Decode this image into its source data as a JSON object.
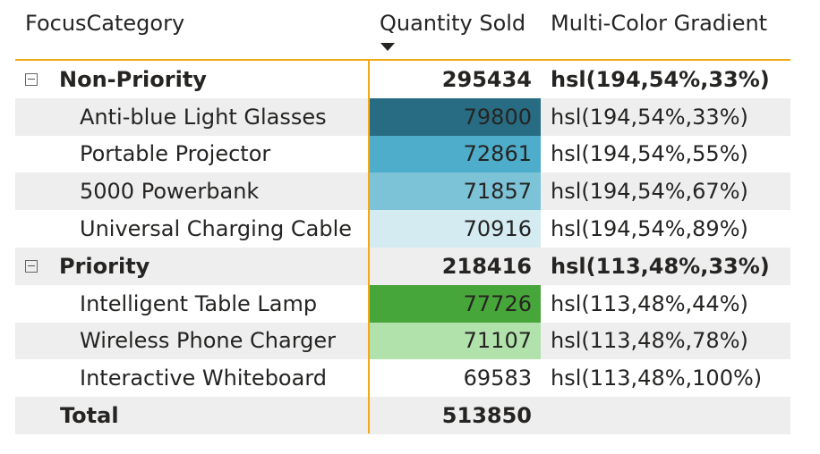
{
  "headers": {
    "category": "FocusCategory",
    "quantity": "Quantity Sold",
    "gradient": "Multi-Color Gradient"
  },
  "sort": {
    "column": "Quantity Sold",
    "direction": "descending"
  },
  "accent_color": "#f2a818",
  "rows": [
    {
      "type": "group",
      "label": "Non-Priority",
      "quantity": "295434",
      "gradient": "hsl(194,54%,33%)",
      "expanded": true
    },
    {
      "type": "item",
      "label": "Anti-blue Light Glasses",
      "quantity": "79800",
      "gradient": "hsl(194,54%,33%)",
      "cell_color": "hsl(194,54%,33%)"
    },
    {
      "type": "item",
      "label": "Portable Projector",
      "quantity": "72861",
      "gradient": "hsl(194,54%,55%)",
      "cell_color": "hsl(194,54%,55%)"
    },
    {
      "type": "item",
      "label": "5000 Powerbank",
      "quantity": "71857",
      "gradient": "hsl(194,54%,67%)",
      "cell_color": "hsl(194,54%,67%)"
    },
    {
      "type": "item",
      "label": "Universal Charging Cable",
      "quantity": "70916",
      "gradient": "hsl(194,54%,89%)",
      "cell_color": "hsl(194,54%,89%)"
    },
    {
      "type": "group",
      "label": "Priority",
      "quantity": "218416",
      "gradient": "hsl(113,48%,33%)",
      "expanded": true
    },
    {
      "type": "item",
      "label": "Intelligent Table Lamp",
      "quantity": "77726",
      "gradient": "hsl(113,48%,44%)",
      "cell_color": "hsl(113,48%,44%)"
    },
    {
      "type": "item",
      "label": "Wireless Phone Charger",
      "quantity": "71107",
      "gradient": "hsl(113,48%,78%)",
      "cell_color": "hsl(113,48%,78%)"
    },
    {
      "type": "item",
      "label": "Interactive Whiteboard",
      "quantity": "69583",
      "gradient": "hsl(113,48%,100%)",
      "cell_color": "hsl(113,48%,100%)"
    },
    {
      "type": "total",
      "label": "Total",
      "quantity": "513850",
      "gradient": ""
    }
  ]
}
